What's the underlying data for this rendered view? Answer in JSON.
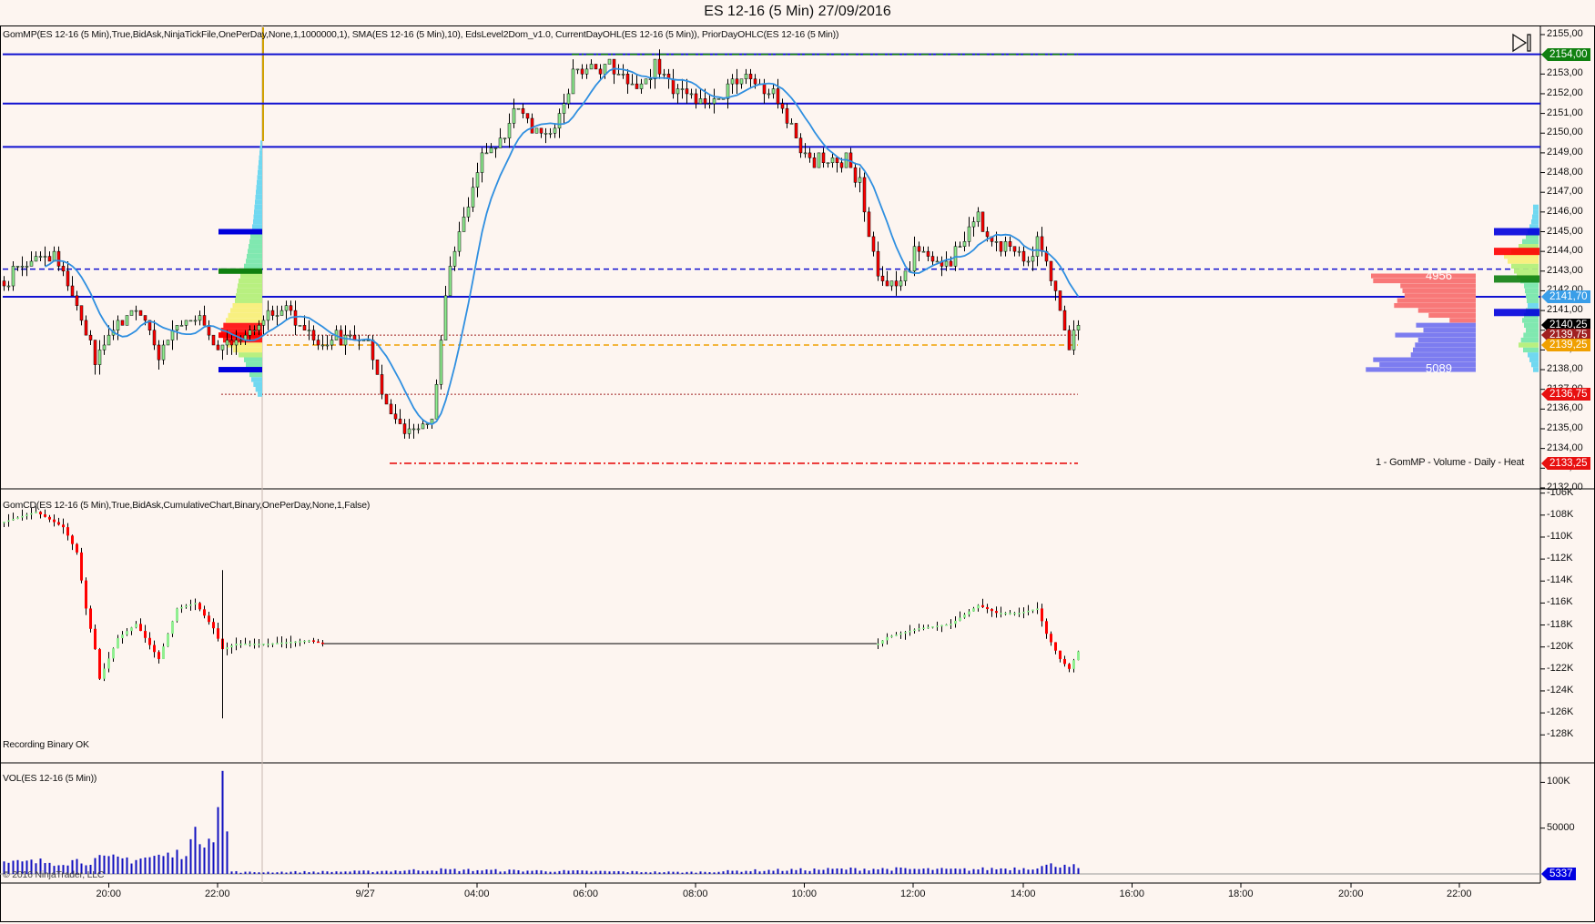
{
  "window": {
    "title": "ES 12-16 (5 Min)  27/09/2016"
  },
  "panels": {
    "price_indicators": "GomMP(ES 12-16 (5 Min),True,BidAsk,NinjaTickFile,OnePerDay,None,1,1000000,1), SMA(ES 12-16 (5 Min),10), EdsLevel2Dom_v1.0, CurrentDayOHL(ES 12-16 (5 Min)), PriorDayOHLC(ES 12-16 (5 Min))",
    "cd_indicators": "GomCD(ES 12-16 (5 Min),True,BidAsk,CumulativeChart,Binary,OnePerDay,None,1,False)",
    "cd_status": "Recording Binary OK",
    "vol_indicators": "VOL(ES 12-16 (5 Min))",
    "copyright": "© 2016 NinjaTrader, LLC",
    "profile_caption": "1 - GomMP - Volume - Daily - Heat",
    "dom_ask_total": "4956",
    "dom_bid_total": "5089",
    "end_button_icon": "skip-to-end-icon"
  },
  "axes": {
    "price_ticks": [
      "2155,00",
      "2154,00",
      "2153,00",
      "2152,00",
      "2151,00",
      "2150,00",
      "2149,00",
      "2148,00",
      "2147,00",
      "2146,00",
      "2145,00",
      "2144,00",
      "2143,00",
      "2142,00",
      "2141,00",
      "2140,00",
      "2139,00",
      "2138,00",
      "2137,00",
      "2136,00",
      "2135,00",
      "2134,00",
      "2133,00",
      "2132,00"
    ],
    "cd_ticks": [
      "-106K",
      "-108K",
      "-110K",
      "-112K",
      "-114K",
      "-116K",
      "-118K",
      "-120K",
      "-122K",
      "-124K",
      "-126K",
      "-128K"
    ],
    "vol_ticks": [
      "100K",
      "50000"
    ],
    "time_ticks": [
      "20:00",
      "22:00",
      "9/27",
      "04:00",
      "06:00",
      "08:00",
      "10:00",
      "12:00",
      "14:00",
      "16:00",
      "18:00",
      "20:00",
      "22:00"
    ]
  },
  "price_markers": [
    {
      "label": "2154,00",
      "price": 2154.0,
      "color": "#108010"
    },
    {
      "label": "2141,70",
      "price": 2141.7,
      "color": "#3a9ee8"
    },
    {
      "label": "2140,25",
      "price": 2140.25,
      "color": "#000000"
    },
    {
      "label": "2139,75",
      "price": 2139.75,
      "color": "#a02020"
    },
    {
      "label": "2139,25",
      "price": 2139.25,
      "color": "#f0a000"
    },
    {
      "label": "2136,75",
      "price": 2136.75,
      "color": "#e81010"
    },
    {
      "label": "2133,25",
      "price": 2133.25,
      "color": "#e81010"
    }
  ],
  "vol_marker": {
    "label": "5337",
    "color": "#0000e0"
  },
  "chart_data": {
    "type": "candlestick",
    "instrument": "ES 12-16 (5 Min)",
    "price_range": [
      2132,
      2155
    ],
    "price_path": [
      [
        0,
        2142.2
      ],
      [
        4,
        2143.5
      ],
      [
        11,
        2143.7
      ],
      [
        15,
        2141.7
      ],
      [
        20,
        2138.5
      ],
      [
        25,
        2140.4
      ],
      [
        29,
        2141.1
      ],
      [
        34,
        2138.8
      ],
      [
        38,
        2140.1
      ],
      [
        42,
        2140.6
      ],
      [
        47,
        2139.1
      ],
      [
        51,
        2139.6
      ],
      [
        58,
        2140.6
      ],
      [
        63,
        2140.9
      ],
      [
        69,
        2139.3
      ],
      [
        76,
        2139.8
      ],
      [
        80,
        2139.1
      ],
      [
        84,
        2136.2
      ],
      [
        88,
        2134.9
      ],
      [
        94,
        2135.4
      ],
      [
        96,
        2139.6
      ],
      [
        98,
        2143.2
      ],
      [
        102,
        2146.3
      ],
      [
        105,
        2148.9
      ],
      [
        109,
        2149.4
      ],
      [
        113,
        2151.5
      ],
      [
        116,
        2150.2
      ],
      [
        121,
        2149.9
      ],
      [
        125,
        2153.1
      ],
      [
        130,
        2153.5
      ],
      [
        134,
        2153.3
      ],
      [
        139,
        2152.3
      ],
      [
        143,
        2153.3
      ],
      [
        147,
        2152.0
      ],
      [
        152,
        2151.8
      ],
      [
        156,
        2151.8
      ],
      [
        161,
        2152.8
      ],
      [
        165,
        2152.6
      ],
      [
        170,
        2151.8
      ],
      [
        172,
        2150.5
      ],
      [
        176,
        2148.9
      ],
      [
        181,
        2148.4
      ],
      [
        185,
        2148.7
      ],
      [
        188,
        2147.4
      ],
      [
        190,
        2144.8
      ],
      [
        192,
        2142.7
      ],
      [
        197,
        2142.4
      ],
      [
        200,
        2144.0
      ],
      [
        204,
        2143.5
      ],
      [
        208,
        2143.5
      ],
      [
        211,
        2144.8
      ],
      [
        214,
        2145.8
      ],
      [
        217,
        2144.2
      ],
      [
        221,
        2144.0
      ],
      [
        225,
        2143.5
      ],
      [
        227,
        2144.5
      ],
      [
        230,
        2142.7
      ],
      [
        232,
        2141.1
      ],
      [
        234,
        2139.1
      ],
      [
        236,
        2140.25
      ]
    ],
    "sma_period": 10,
    "levels": [
      {
        "name": "level-2154",
        "price": 2154.0,
        "color": "#1010d0",
        "style": "solid",
        "from_bar": 0
      },
      {
        "name": "level-2151-5",
        "price": 2151.5,
        "color": "#1010d0",
        "style": "solid",
        "from_bar": 0
      },
      {
        "name": "level-2149-3",
        "price": 2149.3,
        "color": "#1010d0",
        "style": "solid",
        "from_bar": 0
      },
      {
        "name": "level-2141-7",
        "price": 2141.7,
        "color": "#1010d0",
        "style": "solid",
        "from_bar": 0
      },
      {
        "name": "level-2143-1",
        "price": 2143.1,
        "color": "#1010d0",
        "style": "dashed",
        "from_bar": 0
      },
      {
        "name": "current-day-high",
        "price": 2154.0,
        "color": "#108010",
        "style": "dashdot",
        "from_bar": 125
      },
      {
        "name": "current-day-low",
        "price": 2133.25,
        "color": "#e81010",
        "style": "dashdot",
        "from_bar": 85
      },
      {
        "name": "prior-close",
        "price": 2139.25,
        "color": "#f0a000",
        "style": "dashed",
        "from_bar": 58
      },
      {
        "name": "prior-open",
        "price": 2139.75,
        "color": "#a02020",
        "style": "dotted",
        "from_bar": 58
      },
      {
        "name": "prior-low",
        "price": 2136.75,
        "color": "#a02020",
        "style": "dotted",
        "from_bar": 48
      }
    ],
    "cd_range_k": [
      -129,
      -106
    ],
    "cd_path_k": [
      [
        0,
        -108.6
      ],
      [
        7,
        -107.7
      ],
      [
        13,
        -109.1
      ],
      [
        16,
        -111.4
      ],
      [
        18,
        -116.5
      ],
      [
        20,
        -120.2
      ],
      [
        21,
        -122.9
      ],
      [
        25,
        -119.2
      ],
      [
        29,
        -117.9
      ],
      [
        34,
        -121.1
      ],
      [
        38,
        -116.5
      ],
      [
        42,
        -116.0
      ],
      [
        46,
        -118.3
      ],
      [
        48,
        -120.2
      ],
      [
        51,
        -119.7
      ],
      [
        58,
        -119.7
      ],
      [
        67,
        -119.4
      ],
      [
        70,
        -119.7
      ],
      [
        192,
        -119.7
      ],
      [
        194,
        -119.1
      ],
      [
        201,
        -118.3
      ],
      [
        208,
        -117.9
      ],
      [
        214,
        -116.2
      ],
      [
        218,
        -116.9
      ],
      [
        223,
        -116.9
      ],
      [
        227,
        -116.5
      ],
      [
        229,
        -118.8
      ],
      [
        232,
        -121.1
      ],
      [
        234,
        -122.0
      ],
      [
        236,
        -120.4
      ]
    ],
    "cd_flat_bars": [
      70,
      192
    ],
    "volume_path_k": [
      [
        0,
        12
      ],
      [
        10,
        14
      ],
      [
        20,
        16
      ],
      [
        30,
        18
      ],
      [
        38,
        22
      ],
      [
        42,
        40
      ],
      [
        46,
        55
      ],
      [
        48,
        105
      ],
      [
        49,
        45
      ],
      [
        50,
        3
      ],
      [
        52,
        2
      ],
      [
        80,
        3
      ],
      [
        95,
        5
      ],
      [
        110,
        4
      ],
      [
        130,
        3
      ],
      [
        150,
        2
      ],
      [
        165,
        4
      ],
      [
        190,
        6
      ],
      [
        210,
        5
      ],
      [
        225,
        7
      ],
      [
        234,
        12
      ],
      [
        236,
        5.337
      ]
    ],
    "session_profile": [
      [
        2136.75,
        5
      ],
      [
        2137.5,
        12
      ],
      [
        2138.5,
        20
      ],
      [
        2139.25,
        38
      ],
      [
        2139.75,
        48
      ],
      [
        2140.5,
        40
      ],
      [
        2141.5,
        30
      ],
      [
        2142.5,
        26
      ],
      [
        2143.5,
        18
      ],
      [
        2144.5,
        14
      ],
      [
        2145.5,
        10
      ],
      [
        2146.5,
        8
      ],
      [
        2147.5,
        6
      ],
      [
        2148.5,
        4
      ],
      [
        2149.5,
        2
      ]
    ],
    "daily_profile": [
      [
        2138.0,
        6
      ],
      [
        2138.75,
        12
      ],
      [
        2139.25,
        22
      ],
      [
        2140.0,
        14
      ],
      [
        2140.5,
        18
      ],
      [
        2141.25,
        12
      ],
      [
        2141.7,
        14
      ],
      [
        2142.25,
        16
      ],
      [
        2142.75,
        24
      ],
      [
        2143.25,
        30
      ],
      [
        2143.75,
        38
      ],
      [
        2144.25,
        22
      ],
      [
        2144.75,
        14
      ],
      [
        2145.5,
        8
      ],
      [
        2146.0,
        6
      ]
    ],
    "dom_asks": [
      [
        2142.75,
        100
      ],
      [
        2142.5,
        98
      ],
      [
        2142.25,
        72
      ],
      [
        2142.0,
        70
      ],
      [
        2141.75,
        68
      ],
      [
        2141.5,
        75
      ],
      [
        2141.25,
        78
      ],
      [
        2141.0,
        55
      ],
      [
        2140.75,
        45
      ],
      [
        2140.5,
        25
      ]
    ],
    "dom_bids": [
      [
        2140.25,
        57
      ],
      [
        2140.0,
        50
      ],
      [
        2139.75,
        77
      ],
      [
        2139.5,
        55
      ],
      [
        2139.25,
        58
      ],
      [
        2139.0,
        60
      ],
      [
        2138.75,
        62
      ],
      [
        2138.5,
        98
      ],
      [
        2138.25,
        92
      ],
      [
        2138.0,
        105
      ]
    ]
  }
}
